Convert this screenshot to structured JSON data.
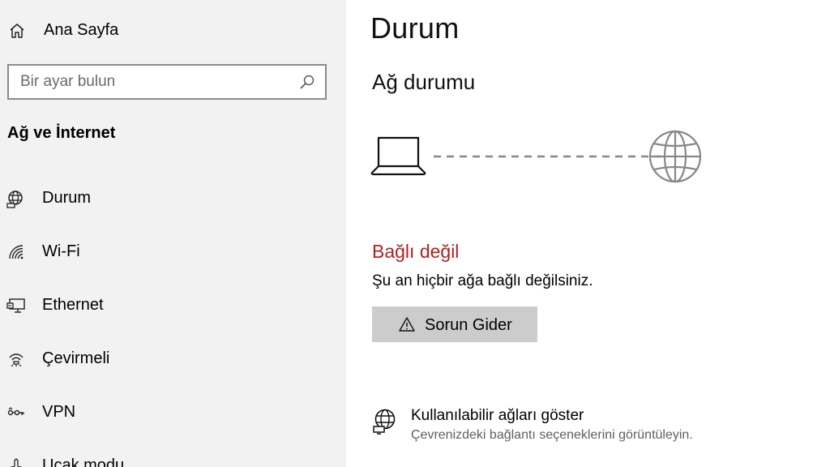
{
  "sidebar": {
    "home_label": "Ana Sayfa",
    "search_placeholder": "Bir ayar bulun",
    "section_title": "Ağ ve İnternet",
    "items": [
      {
        "label": "Durum",
        "icon": "globe-network-icon"
      },
      {
        "label": "Wi-Fi",
        "icon": "wifi-icon"
      },
      {
        "label": "Ethernet",
        "icon": "ethernet-icon"
      },
      {
        "label": "Çevirmeli",
        "icon": "dialup-icon"
      },
      {
        "label": "VPN",
        "icon": "vpn-icon"
      },
      {
        "label": "Uçak modu",
        "icon": "airplane-icon"
      }
    ]
  },
  "main": {
    "title": "Durum",
    "subtitle": "Ağ durumu",
    "status_title": "Bağlı değil",
    "status_description": "Şu an hiçbir ağa bağlı değilsiniz.",
    "troubleshoot_label": "Sorun Gider",
    "available_networks": {
      "title": "Kullanılabilir ağları göster",
      "description": "Çevrenizdeki bağlantı seçeneklerini görüntüleyin."
    }
  },
  "colors": {
    "sidebar_bg": "#f2f2f2",
    "status_error": "#b21f1f",
    "button_bg": "#cccccc"
  }
}
